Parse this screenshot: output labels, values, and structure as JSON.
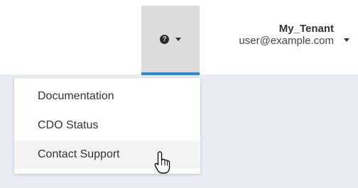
{
  "header": {
    "help_icon": "question-mark-icon",
    "tenant_name": "My_Tenant",
    "user_email": "user@example.com"
  },
  "help_menu": {
    "items": [
      {
        "label": "Documentation"
      },
      {
        "label": "CDO Status"
      },
      {
        "label": "Contact Support"
      }
    ]
  },
  "colors": {
    "active_underline": "#2a8ccf",
    "content_background": "#e9ecf3",
    "help_button_background": "#dcdcdc"
  }
}
